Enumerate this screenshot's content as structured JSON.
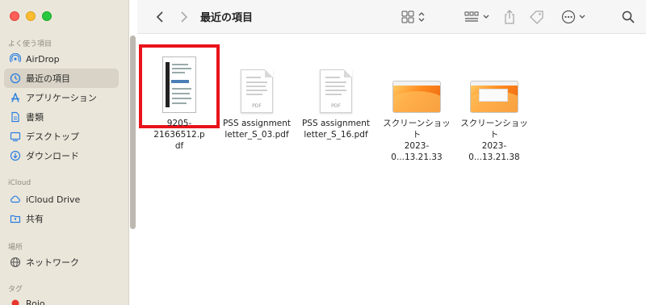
{
  "window": {
    "title": "最近の項目"
  },
  "sidebar": {
    "favorites_header": "よく使う項目",
    "icloud_header": "iCloud",
    "locations_header": "場所",
    "tags_header": "タグ",
    "items": [
      {
        "label": "AirDrop",
        "icon": "airdrop-icon"
      },
      {
        "label": "最近の項目",
        "icon": "clock-icon",
        "selected": true
      },
      {
        "label": "アプリケーション",
        "icon": "applications-icon"
      },
      {
        "label": "書類",
        "icon": "document-icon"
      },
      {
        "label": "デスクトップ",
        "icon": "desktop-icon"
      },
      {
        "label": "ダウンロード",
        "icon": "download-icon"
      }
    ],
    "icloud_items": [
      {
        "label": "iCloud Drive",
        "icon": "cloud-icon"
      },
      {
        "label": "共有",
        "icon": "shared-folder-icon"
      }
    ],
    "location_items": [
      {
        "label": "ネットワーク",
        "icon": "network-icon"
      }
    ],
    "tag_items": [
      {
        "label": "Rojo",
        "color": "#e8352e"
      }
    ]
  },
  "toolbar": {
    "icons": [
      "back-icon",
      "forward-icon",
      "grid-view-icon",
      "group-icon",
      "share-icon",
      "tag-icon",
      "more-icon",
      "search-icon"
    ]
  },
  "files": [
    {
      "name_line1": "9205-21636512.p",
      "name_line2": "df",
      "type": "pdf-dark",
      "highlighted": true
    },
    {
      "name_line1": "PSS assignment",
      "name_line2": "letter_S_03.pdf",
      "type": "pdf",
      "thumb_label": "PDF"
    },
    {
      "name_line1": "PSS assignment",
      "name_line2": "letter_S_16.pdf",
      "type": "pdf",
      "thumb_label": "PDF"
    },
    {
      "name_line1": "スクリーンショット",
      "name_line2": "2023-0...13.21.33",
      "type": "screenshot"
    },
    {
      "name_line1": "スクリーンショット",
      "name_line2": "2023-0...13.21.38",
      "type": "screenshot-window"
    }
  ],
  "colors": {
    "sidebar_bg": "#ebe6da",
    "highlight_border": "#e8131b",
    "tag_red": "#e8352e"
  }
}
